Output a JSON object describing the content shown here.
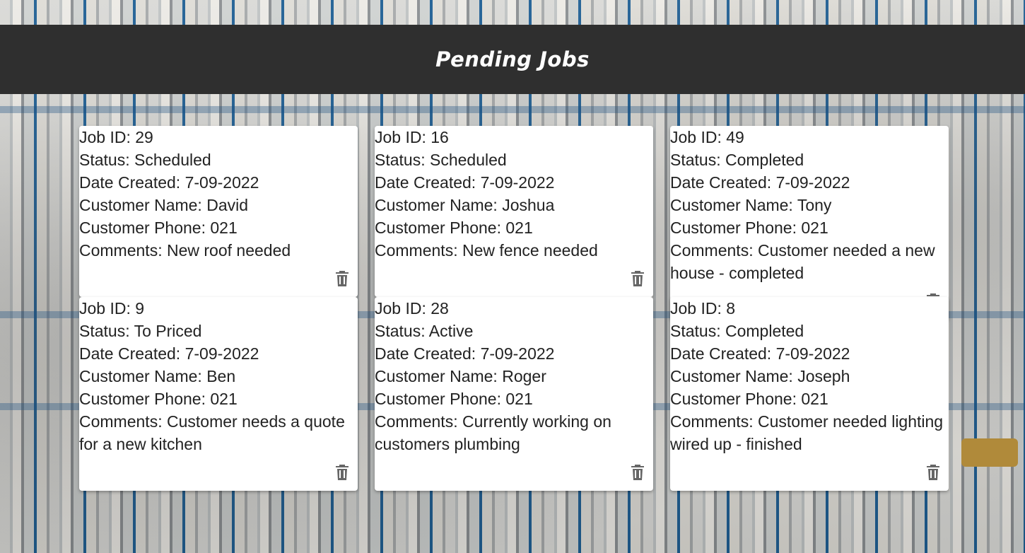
{
  "header": {
    "title": "Pending Jobs"
  },
  "labels": {
    "job_id": "Job ID:",
    "status": "Status:",
    "date_created": "Date Created:",
    "customer_name": "Customer Name:",
    "customer_phone": "Customer Phone:",
    "comments": "Comments:"
  },
  "jobs": [
    {
      "job_id": "29",
      "status": "Scheduled",
      "date_created": "7-09-2022",
      "customer_name": "David",
      "customer_phone": "021",
      "comments": "New roof needed"
    },
    {
      "job_id": "16",
      "status": "Scheduled",
      "date_created": "7-09-2022",
      "customer_name": "Joshua",
      "customer_phone": "021",
      "comments": "New fence needed"
    },
    {
      "job_id": "49",
      "status": "Completed",
      "date_created": "7-09-2022",
      "customer_name": "Tony",
      "customer_phone": "021",
      "comments": "Customer needed a new house - completed"
    },
    {
      "job_id": "9",
      "status": "To Priced",
      "date_created": "7-09-2022",
      "customer_name": "Ben",
      "customer_phone": "021",
      "comments": "Customer needs a quote for a new kitchen"
    },
    {
      "job_id": "28",
      "status": "Active",
      "date_created": "7-09-2022",
      "customer_name": "Roger",
      "customer_phone": "021",
      "comments": "Currently working on customers plumbing"
    },
    {
      "job_id": "8",
      "status": "Completed",
      "date_created": "7-09-2022",
      "customer_name": "Joseph",
      "customer_phone": "021",
      "comments": "Customer needed lighting wired up - finished"
    }
  ],
  "icons": {
    "delete": "trash-icon"
  },
  "colors": {
    "header_bg": "#2f2f2f",
    "card_bg": "#ffffff",
    "text": "#222222",
    "icon": "#666666"
  }
}
